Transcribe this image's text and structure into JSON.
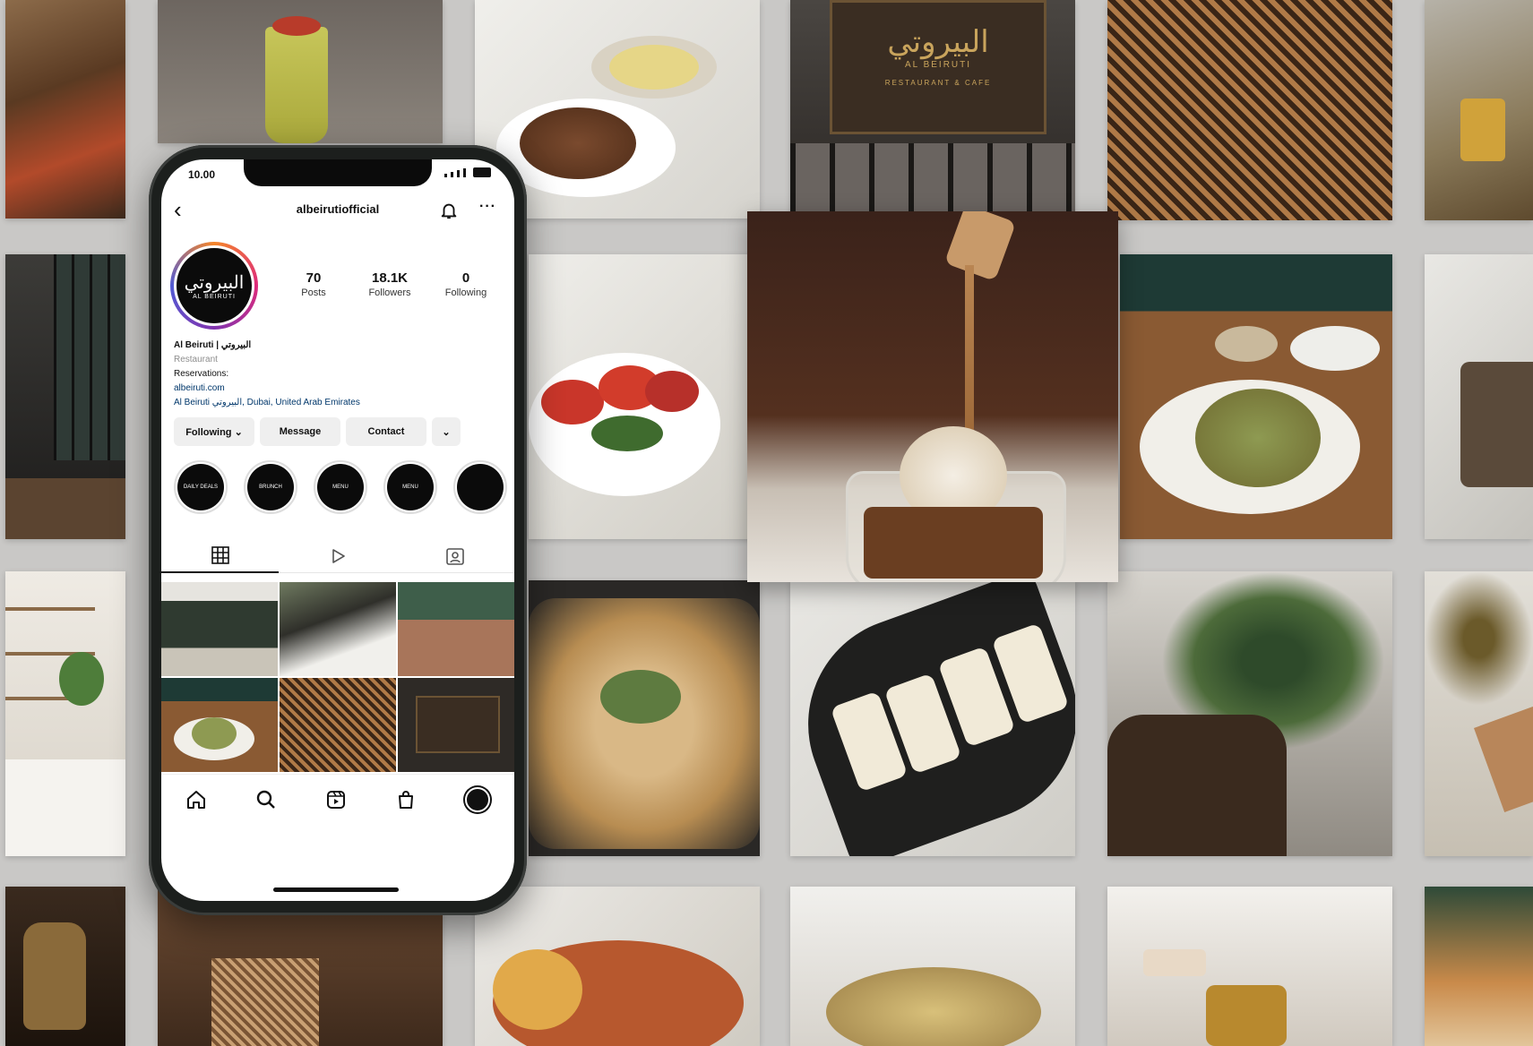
{
  "statusbar": {
    "time": "10.00"
  },
  "profile": {
    "username": "albeirutiofficial",
    "avatar_text_ar": "البيروتي",
    "avatar_text_en": "AL BEIRUTI",
    "stats": [
      {
        "value": "70",
        "label": "Posts"
      },
      {
        "value": "18.1K",
        "label": "Followers"
      },
      {
        "value": "0",
        "label": "Following"
      }
    ],
    "bio": {
      "name": "Al Beiruti | البيروتي",
      "category": "Restaurant",
      "reservations": "Reservations:",
      "website": "albeiruti.com",
      "location": "Al Beiruti البيروتي, Dubai, United Arab Emirates"
    },
    "buttons": {
      "following": "Following ⌄",
      "message": "Message",
      "contact": "Contact",
      "more": "⌄"
    },
    "highlights": [
      "DAILY DEALS",
      "BRUNCH",
      "MENU",
      "MENU",
      ""
    ]
  },
  "sign": {
    "arabic": "البيروتي",
    "english": "AL BEIRUTI",
    "tagline": "RESTAURANT & CAFE"
  },
  "colors": {
    "background": "#c9c8c6",
    "dark_green": "#1f3b35",
    "wood": "#8a5a33",
    "marble": "#ecebe7",
    "sign_gold": "#c9a45c"
  }
}
